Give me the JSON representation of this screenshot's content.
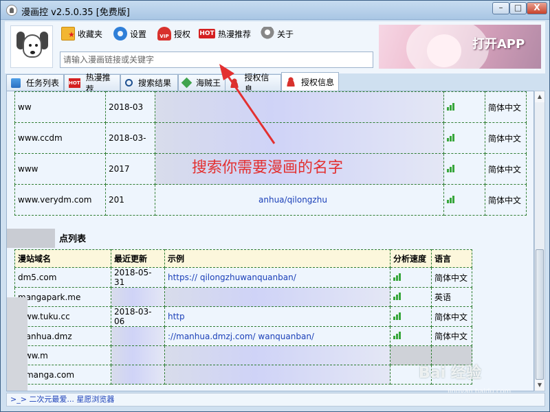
{
  "window": {
    "title": "漫画控 v2.5.0.35 [免费版]",
    "min": "–",
    "max": "□",
    "close": "X"
  },
  "toolbar": {
    "favorites": "收藏夹",
    "settings": "设置",
    "license": "授权",
    "hot": "热漫推荐",
    "about": "关于",
    "hot_badge": "HOT",
    "vip_badge": "VIP"
  },
  "search": {
    "placeholder": "请输入漫画链接或关键字"
  },
  "banner": {
    "label": "打开APP"
  },
  "tabs": [
    {
      "label": "任务列表"
    },
    {
      "label": "热漫推荐",
      "badge": "HOT"
    },
    {
      "label": "搜索结果"
    },
    {
      "label": "海贼王"
    },
    {
      "label": "授权信息"
    },
    {
      "label": "授权信息"
    }
  ],
  "table1": {
    "rows": [
      {
        "site": "ww",
        "date": "2018-03",
        "url": "",
        "lang": "简体中文"
      },
      {
        "site": "www.ccdm",
        "date": "2018-03-",
        "url": "",
        "lang": "简体中文"
      },
      {
        "site": "www",
        "date": "2017",
        "url": "",
        "lang": "简体中文"
      },
      {
        "site": "www.verydm.com",
        "date": "201",
        "url": "anhua/qilongzhu",
        "lang": "简体中文"
      }
    ]
  },
  "section2": {
    "title": "点列表"
  },
  "table2": {
    "headers": [
      "漫站域名",
      "最近更新",
      "示例",
      "分析速度",
      "语言"
    ],
    "rows": [
      {
        "site": "dm5.com",
        "date": "2018-05-31",
        "url": "https:// qilongzhuwanquanban/",
        "lang": "简体中文"
      },
      {
        "site": "mangapark.me",
        "date": "",
        "url": "",
        "lang": "英语"
      },
      {
        "site": "www.tuku.cc",
        "date": "2018-03-06",
        "url": "http",
        "lang": "简体中文"
      },
      {
        "site": "manhua.dmz",
        "date": "",
        "url": "://manhua.dmzj.com/ wanquanban/",
        "lang": "简体中文"
      },
      {
        "site": "www.m",
        "date": "",
        "url": "",
        "lang": ""
      },
      {
        "site": "jpmanga.com",
        "date": "",
        "url": "",
        "lang": ""
      }
    ]
  },
  "annotation": {
    "text": "搜索你需要漫画的名字",
    "color": "#e33030"
  },
  "status": {
    "text": ">_> 二次元最爱... 星愿浏览器"
  },
  "watermark": {
    "text": "Bai 经验",
    "sub": "jingyan.baidu.com"
  }
}
